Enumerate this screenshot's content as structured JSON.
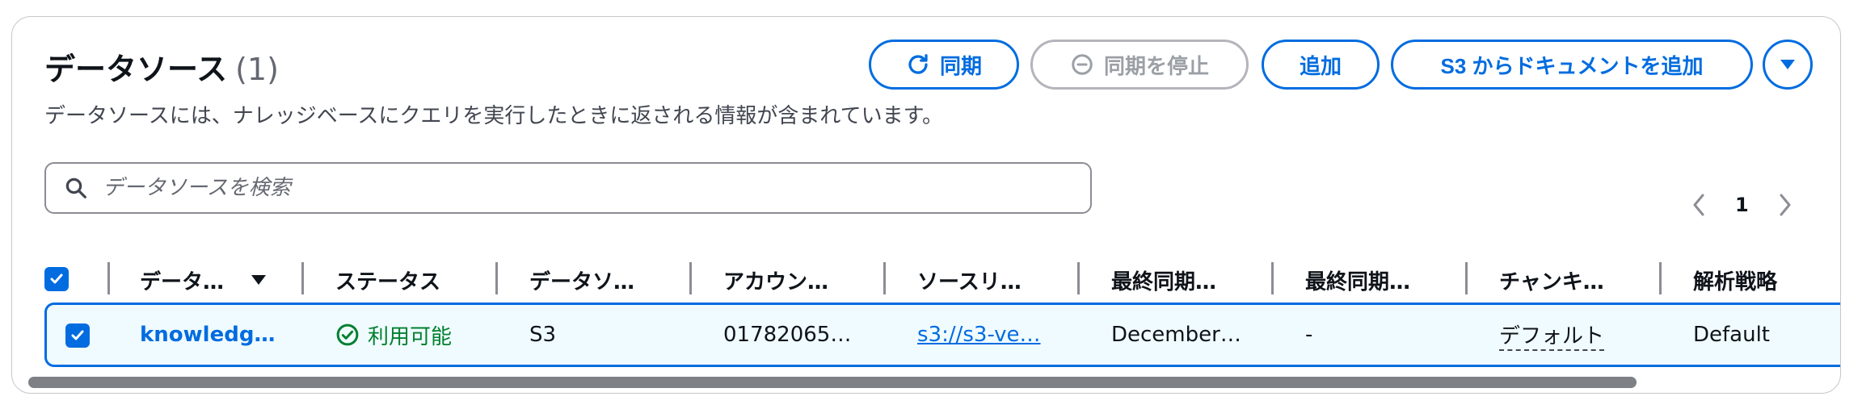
{
  "header": {
    "title": "データソース",
    "count": "(1)",
    "description": "データソースには、ナレッジベースにクエリを実行したときに返される情報が含まれています。"
  },
  "actions": {
    "sync_label": "同期",
    "stop_sync_label": "同期を停止",
    "add_label": "追加",
    "add_from_s3_label": "S3 からドキュメントを追加"
  },
  "search": {
    "placeholder": "データソースを検索"
  },
  "pagination": {
    "current_page": "1"
  },
  "table": {
    "columns": [
      "データ…",
      "ステータス",
      "データソ…",
      "アカウン…",
      "ソースリ…",
      "最終同期…",
      "最終同期…",
      "チャンキ…",
      "解析戦略"
    ],
    "rows": [
      {
        "name": "knowledg…",
        "status": "利用可能",
        "type": "S3",
        "account": "01782065…",
        "source": "s3://s3-ve…",
        "last_sync_time": "December…",
        "last_sync_status": "-",
        "chunking": "デフォルト",
        "parsing": "Default"
      }
    ]
  },
  "colors": {
    "accent": "#006ce0",
    "success": "#00802f",
    "row_highlight": "#f0fbff"
  },
  "icons": [
    "refresh-icon",
    "stop-circle-icon",
    "caret-down-icon",
    "search-icon",
    "chevron-left-icon",
    "chevron-right-icon",
    "check-circle-icon",
    "checkbox-checked-icon",
    "sort-descending-icon"
  ]
}
